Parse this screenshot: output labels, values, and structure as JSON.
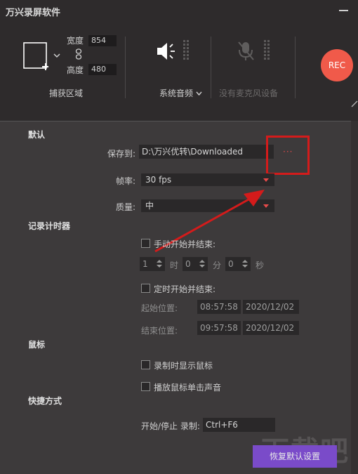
{
  "window": {
    "title": "万兴录屏软件"
  },
  "capture": {
    "width_label": "宽度",
    "width_value": "854",
    "height_label": "高度",
    "height_value": "480",
    "area_label": "捕获区域"
  },
  "audio": {
    "system_label": "系统音频",
    "mic_label": "没有麦克风设备"
  },
  "rec_label": "REC",
  "defaults": {
    "heading": "默认",
    "save_label": "保存到:",
    "save_path": "D:\\万兴优转\\Downloaded",
    "browse_label": "···",
    "fps_label": "帧率:",
    "fps_value": "30 fps",
    "quality_label": "质量:",
    "quality_value": "中"
  },
  "timer": {
    "heading": "记录计时器",
    "manual_label": "手动开始并结束:",
    "hours_value": "1",
    "hours_unit": "时",
    "minutes_value": "0",
    "minutes_unit": "分",
    "seconds_value": "0",
    "seconds_unit": "秒",
    "scheduled_label": "定时开始并结束:",
    "start_label": "起始位置:",
    "start_time": "08:57:58",
    "start_date": "2020/12/02",
    "end_label": "结束位置:",
    "end_time": "09:57:58",
    "end_date": "2020/12/02"
  },
  "mouse": {
    "heading": "鼠标",
    "show_cursor_label": "录制时显示鼠标",
    "click_sound_label": "播放鼠标单击声音"
  },
  "shortcuts": {
    "heading": "快捷方式",
    "start_stop_label": "开始/停止 录制:",
    "start_stop_value": "Ctrl+F6"
  },
  "restore_label": "恢复默认设置",
  "watermark_text": "下载吧",
  "colors": {
    "accent": "#7a4bc9",
    "rec": "#f05a4a",
    "highlight": "#d41b1b",
    "dropdown_arrow": "#e64a4a"
  }
}
